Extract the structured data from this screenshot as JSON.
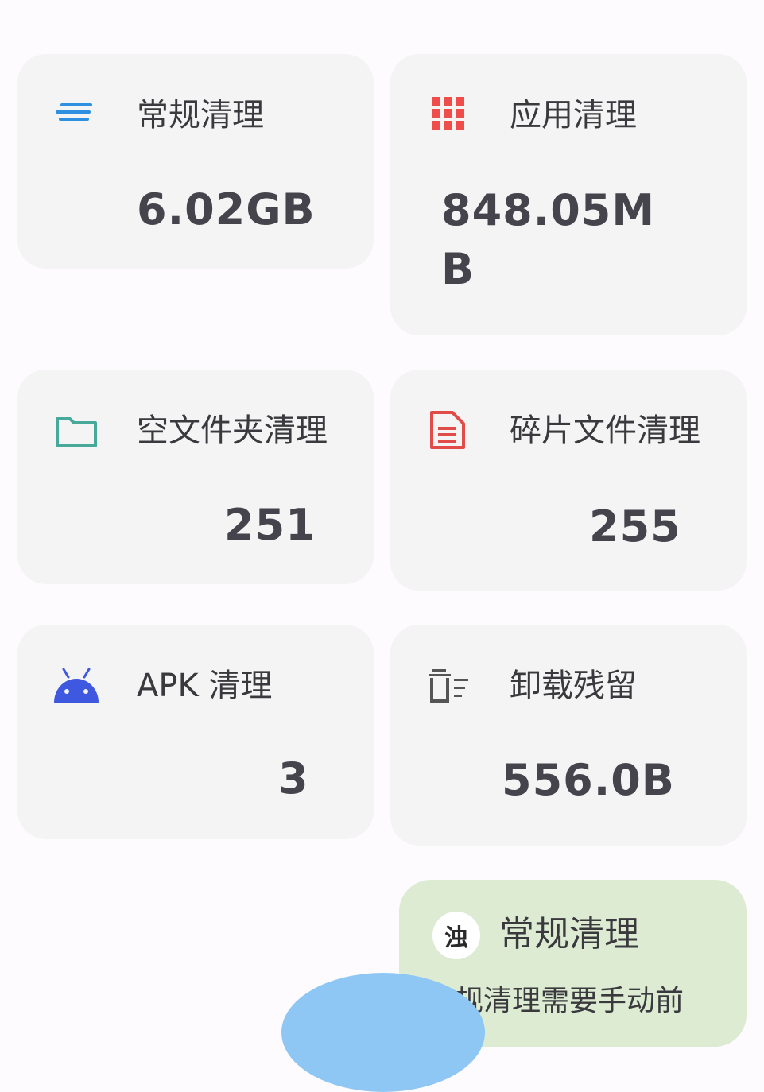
{
  "colors": {
    "background": "#fdfbfd",
    "card": "#f4f4f4",
    "popup": "#dcebd2",
    "fab": "#8ec7f4",
    "general_icon": "#2f8fe0",
    "app_icon": "#ef4d4b",
    "folder_icon": "#47a99a",
    "frag_icon": "#e24c48",
    "apk_icon": "#3f58e0",
    "residue_icon": "#555555"
  },
  "cards": {
    "general": {
      "icon": "lines-icon",
      "title": "常规清理",
      "value": "6.02GB"
    },
    "app": {
      "icon": "grid-icon",
      "title": "应用清理",
      "value": "848.05MB"
    },
    "folder": {
      "icon": "folder-icon",
      "title": "空文件夹清理",
      "value": "251"
    },
    "frag": {
      "icon": "document-icon",
      "title": "碎片文件清理",
      "value": "255"
    },
    "apk": {
      "icon": "android-icon",
      "title": "APK 清理",
      "value": "3"
    },
    "residue": {
      "icon": "trash-list-icon",
      "title": "卸载残留",
      "value": "556.0B"
    }
  },
  "popup": {
    "badge": "浊",
    "title": "常规清理",
    "description": "规清理需要手动前"
  }
}
